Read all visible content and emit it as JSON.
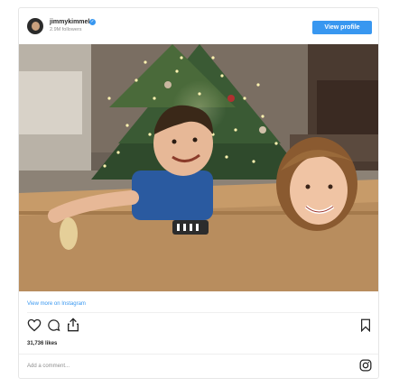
{
  "header": {
    "username": "jimmykimmel",
    "followers": "2.9M followers",
    "view_profile_label": "View profile",
    "verified_glyph": "✓"
  },
  "post": {
    "image_alt": "Two children peeking out of a cardboard box in front of a lit Christmas tree",
    "view_more_label": "View more on Instagram",
    "likes": "31,736 likes",
    "comment_placeholder": "Add a comment..."
  },
  "icons": [
    "heart-icon",
    "comment-icon",
    "share-icon",
    "bookmark-icon",
    "instagram-icon"
  ],
  "colors": {
    "accent": "#3897f0",
    "text": "#262626",
    "muted": "#8e8e8e",
    "border": "#e6e6e6"
  }
}
